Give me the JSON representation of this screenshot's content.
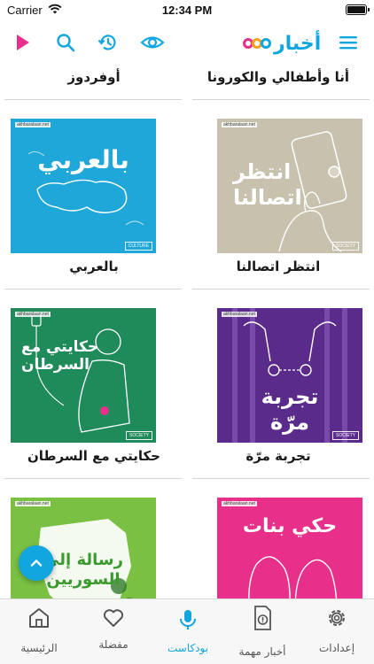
{
  "status_bar": {
    "carrier": "Carrier",
    "time": "12:34 PM"
  },
  "header": {
    "logo_text": "أخبار",
    "logo_colors": [
      "#e8308a",
      "#f2a21b",
      "#12a6e0"
    ],
    "icons": [
      "play-icon",
      "search-icon",
      "history-icon",
      "eye-icon",
      "menu-icon"
    ],
    "accent": "#12a6e0",
    "play_color": "#e8308a"
  },
  "podcasts": {
    "top_row": {
      "right_title": "أنا وأطفالي والكورونا",
      "left_title": "أوفردوز"
    },
    "items": [
      {
        "title": "انتظر اتصالنا",
        "headline": "انتظر اتصالنا",
        "category": "SOCIETY",
        "source": "akhbaralaan.net",
        "color": "#c8c1ae"
      },
      {
        "title": "بالعربي",
        "headline": "بالعربي",
        "category": "CULTURE",
        "source": "akhbaralaan.net",
        "color": "#1ea7d8"
      },
      {
        "title": "تجربة مرّة",
        "headline": "تجربة مرّة",
        "category": "SOCIETY",
        "source": "akhbaralaan.net",
        "color": "#5a2b8a"
      },
      {
        "title": "حكايتي مع السرطان",
        "headline": "حكايتي مع السرطان",
        "category": "SOCIETY",
        "source": "akhbaralaan.net",
        "color": "#1f8a5a"
      },
      {
        "title": "",
        "headline": "حكي بنات",
        "category": "",
        "source": "akhbaralaan.net",
        "color": "#e8308a"
      },
      {
        "title": "",
        "headline": "رسالة إلى السوريين",
        "category": "",
        "source": "akhbaralaan.net",
        "color": "#7ac043"
      }
    ]
  },
  "tabs": [
    {
      "label": "إعدادات",
      "icon": "gear-icon",
      "active": false
    },
    {
      "label": "أخبار مهمة",
      "icon": "important-news-icon",
      "active": false
    },
    {
      "label": "بودكاست",
      "icon": "microphone-icon",
      "active": true
    },
    {
      "label": "مفضلة",
      "icon": "heart-icon",
      "active": false
    },
    {
      "label": "الرئيسية",
      "icon": "home-icon",
      "active": false
    }
  ]
}
